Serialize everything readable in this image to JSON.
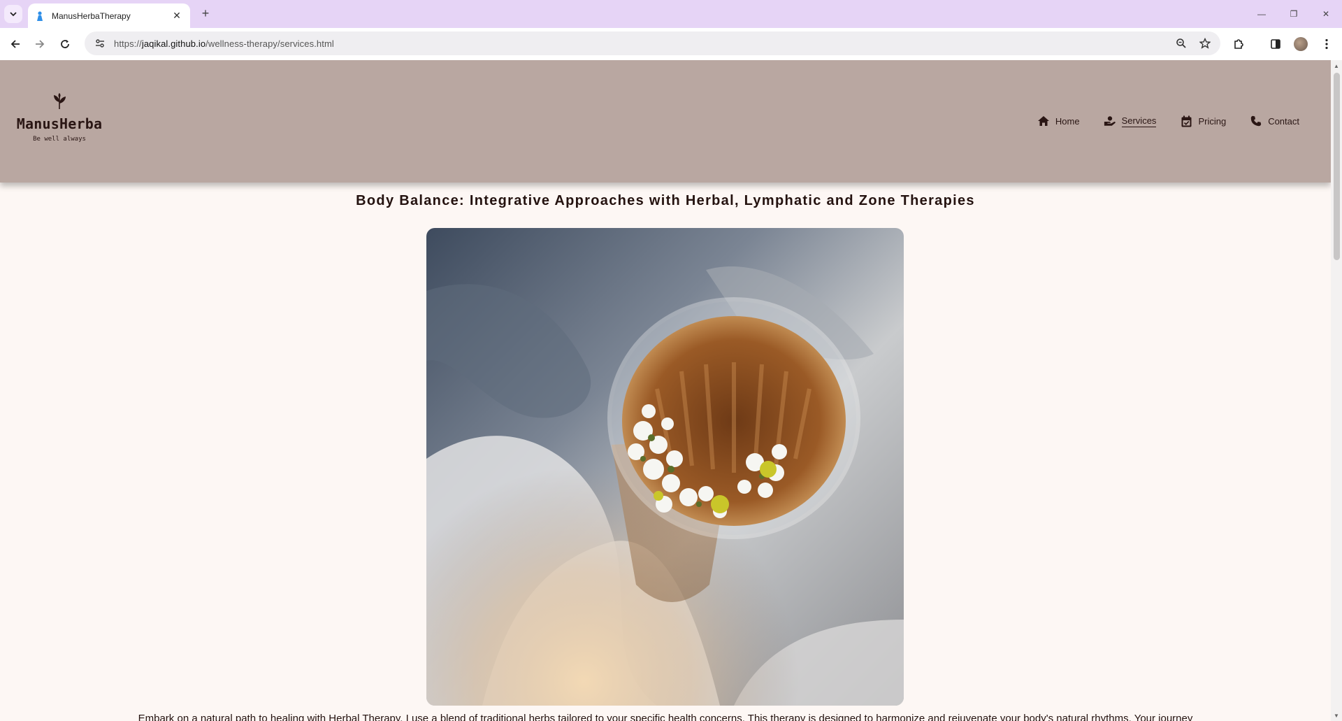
{
  "browser": {
    "tab_title": "ManusHerbaTherapy",
    "url_scheme": "https://",
    "url_host": "jaqikal.github.io",
    "url_path": "/wellness-therapy/services.html",
    "accent_color": "#e6d4f6"
  },
  "site": {
    "logo_name": "ManusHerba",
    "logo_tagline": "Be well always",
    "header_color": "#b9a7a1",
    "nav": [
      {
        "label": "Home",
        "icon": "home-icon"
      },
      {
        "label": "Services",
        "icon": "hand-holding-icon",
        "active": true
      },
      {
        "label": "Pricing",
        "icon": "calendar-icon"
      },
      {
        "label": "Contact",
        "icon": "phone-icon"
      }
    ]
  },
  "main": {
    "title": "Body Balance: Integrative Approaches with Herbal, Lymphatic and Zone Therapies",
    "hero_image": "herbal-tea-glass-with-chamomile-flowers",
    "intro_text": "Embark on a natural path to healing with Herbal Therapy. I use a blend of traditional herbs tailored to your specific health concerns. This therapy is designed to harmonize and rejuvenate your body's natural rhythms. Your journey"
  }
}
